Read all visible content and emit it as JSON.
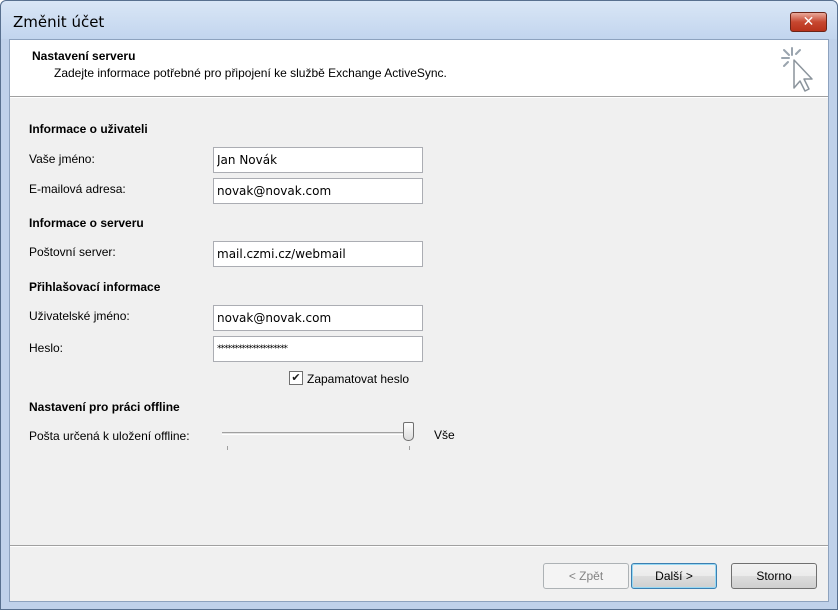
{
  "window": {
    "title": "Změnit účet",
    "close_label": "✕"
  },
  "header": {
    "title": "Nastavení serveru",
    "description": "Zadejte informace potřebné pro připojení ke službě Exchange ActiveSync."
  },
  "user_info": {
    "heading": "Informace o uživateli",
    "name_label": "Vaše jméno:",
    "name_value": "Jan Novák",
    "email_label": "E-mailová adresa:",
    "email_value": "novak@novak.com"
  },
  "server_info": {
    "heading": "Informace o serveru",
    "server_label": "Poštovní server:",
    "server_value": "mail.czmi.cz/webmail"
  },
  "login_info": {
    "heading": "Přihlašovací informace",
    "username_label": "Uživatelské jméno:",
    "username_value": "novak@novak.com",
    "password_label": "Heslo:",
    "password_value": "********************",
    "remember_label": "Zapamatovat heslo",
    "remember_checked": true
  },
  "offline": {
    "heading": "Nastavení pro práci offline",
    "mail_label": "Pošta určená k uložení offline:",
    "slider_value_label": "Vše",
    "slider_fraction": 1.0
  },
  "buttons": {
    "back": "< Zpět",
    "next": "Další >",
    "cancel": "Storno"
  },
  "colors": {
    "titlebar": "#c2d5ee",
    "close": "#c74730",
    "body": "#f0f0f0",
    "default_button_border": "#3c7fb1"
  }
}
